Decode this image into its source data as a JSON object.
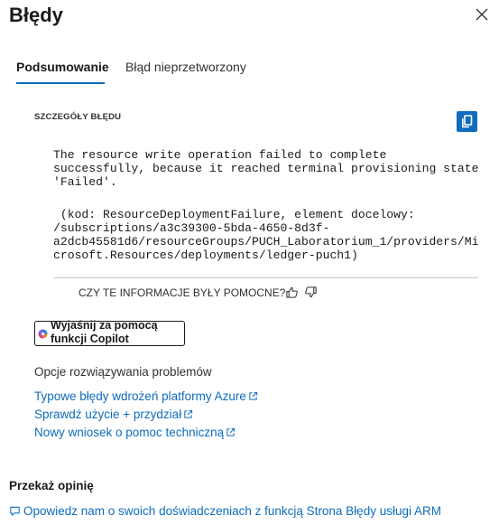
{
  "header": {
    "title": "Błędy",
    "close_icon": "close-icon"
  },
  "tabs": [
    {
      "label": "Podsumowanie",
      "active": true
    },
    {
      "label": "Błąd nieprzetworzony",
      "active": false
    }
  ],
  "details": {
    "section_label": "SZCZEGÓŁY BŁĘDU",
    "copy_icon": "copy-icon",
    "message": "The resource write operation failed to complete\nsuccessfully, because it reached terminal provisioning state\n'Failed'.",
    "code_text": " (kod: ResourceDeploymentFailure, element docelowy:\n/subscriptions/a3c39300-5bda-4650-8d3f-\na2dcb45581d6/resourceGroups/PUCH_Laboratorium_1/providers/Mi\ncrosoft.Resources/deployments/ledger-puch1)",
    "helpful_question": "CZY TE INFORMACJE BYŁY POMOCNE?"
  },
  "copilot": {
    "label": "Wyjaśnij za pomocą funkcji Copilot"
  },
  "troubleshooting": {
    "heading": "Opcje rozwiązywania problemów",
    "links": [
      "Typowe błędy wdrożeń platformy Azure",
      "Sprawdź użycie + przydział",
      "Nowy wniosek o pomoc techniczną"
    ]
  },
  "feedback": {
    "heading": "Przekaż opinię",
    "link": "Opowiedz nam o swoich doświadczeniach z funkcją Strona Błędy usługi ARM"
  },
  "colors": {
    "accent": "#0f6cbd",
    "text": "#323130"
  }
}
